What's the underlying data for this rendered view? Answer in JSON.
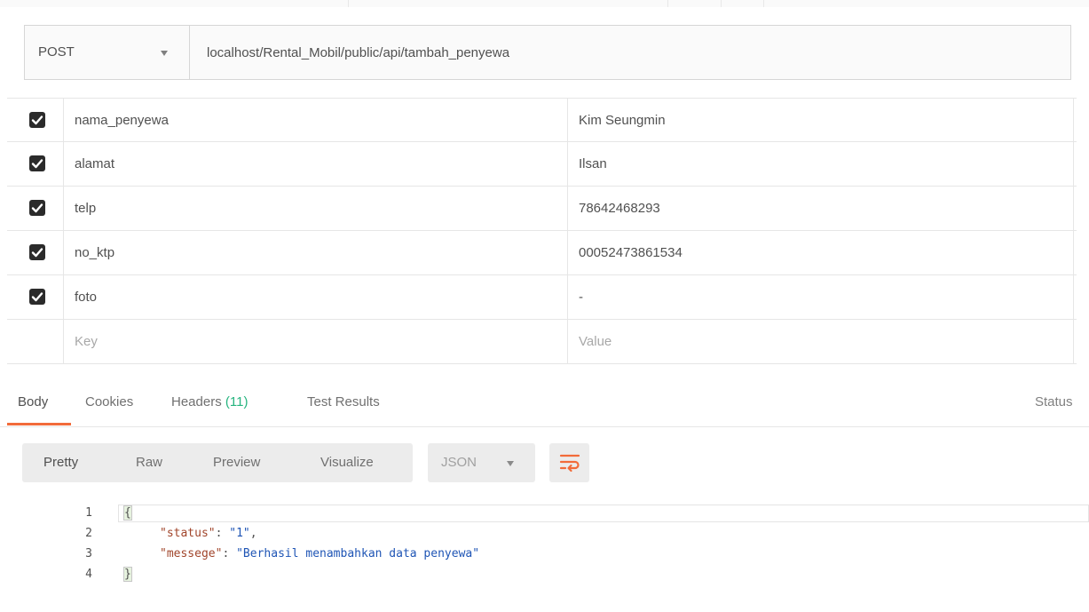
{
  "request": {
    "method": "POST",
    "url": "localhost/Rental_Mobil/public/api/tambah_penyewa"
  },
  "params": [
    {
      "checked": true,
      "key": "nama_penyewa",
      "value": "Kim Seungmin"
    },
    {
      "checked": true,
      "key": "alamat",
      "value": "Ilsan"
    },
    {
      "checked": true,
      "key": "telp",
      "value": "78642468293"
    },
    {
      "checked": true,
      "key": "no_ktp",
      "value": "00052473861534"
    },
    {
      "checked": true,
      "key": "foto",
      "value": "-"
    }
  ],
  "new_param": {
    "key_placeholder": "Key",
    "value_placeholder": "Value"
  },
  "response_tabs": {
    "body": "Body",
    "cookies": "Cookies",
    "headers": "Headers",
    "headers_count": "(11)",
    "test_results": "Test Results",
    "status": "Status"
  },
  "view_modes": [
    "Pretty",
    "Raw",
    "Preview",
    "Visualize"
  ],
  "format": "JSON",
  "icons": {
    "checkbox": "checkmark-icon",
    "wrap": "wrap-lines-icon",
    "dropdown": "caret-down-icon"
  },
  "colors": {
    "accent": "#f26b3a",
    "headers_count": "#26b47f",
    "json_key": "#a1452b",
    "json_string": "#1f55b5"
  },
  "code": {
    "line_numbers": [
      "1",
      "2",
      "3",
      "4"
    ],
    "open_brace": "{",
    "close_brace": "}",
    "lines": [
      {
        "key": "\"status\"",
        "value": "\"1\"",
        "trailing": ","
      },
      {
        "key": "\"messege\"",
        "value": "\"Berhasil menambahkan data penyewa\"",
        "trailing": ""
      }
    ]
  }
}
